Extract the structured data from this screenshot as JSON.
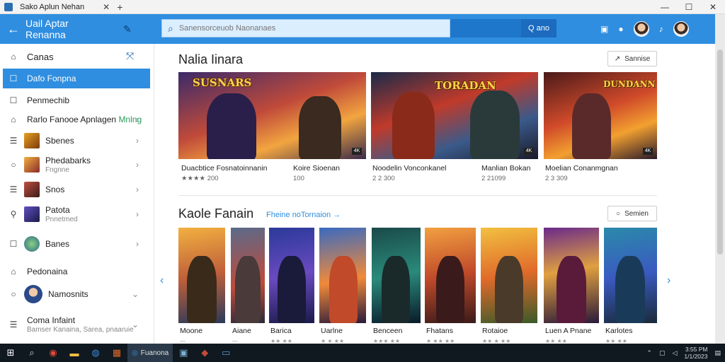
{
  "window": {
    "title": "Sako Aplun Nehan",
    "controls": [
      "—",
      "☐",
      "✕"
    ]
  },
  "header": {
    "app_name": "Uail Aptar Renanna",
    "search_placeholder": "Sanensorceuob Naonanaes",
    "search_button": "Q ano"
  },
  "sidebar": {
    "items": [
      {
        "label": "Canas",
        "icon": "home-icon"
      },
      {
        "label": "Dafo Fonpna",
        "icon": "square-icon",
        "active": true
      },
      {
        "label": "Penmechib",
        "icon": "checkbox-icon"
      },
      {
        "label": "Rarlo Fanooe Apnlagen",
        "label_accent": "Mnlng",
        "icon": "home-icon"
      },
      {
        "label": "Sbenes",
        "icon": "list-icon"
      },
      {
        "label": "Phedabarks",
        "sub": "Fngnne",
        "icon": "chat-icon"
      },
      {
        "label": "Snos",
        "icon": "list-icon"
      },
      {
        "label": "Patota",
        "sub": "Pnnetmed",
        "icon": "pin-icon"
      },
      {
        "label": "Banes",
        "icon": "checkbox-icon"
      },
      {
        "label": "Pedonaina",
        "icon": "home-icon"
      },
      {
        "label": "Namosnits",
        "icon": "chat-icon"
      },
      {
        "label": "Coma Infaint",
        "sub": "Bamser Kanaina, Sarea, pnaaruie",
        "icon": "list-icon"
      }
    ]
  },
  "featured": {
    "title": "Nalia Iinara",
    "button": "Sannise",
    "cards": [
      {
        "name": "Duacbtice Fosnatoinnanin",
        "rating": "★★★★ 200",
        "logo": "SUSNARS",
        "name2": "Koire Sioenan",
        "sub2": "100"
      },
      {
        "name": "Noodelin Vonconkanel",
        "rating": "2 2 300",
        "logo": "TORADAN",
        "name2": "Manlian Bokan",
        "sub2": "2 21099"
      },
      {
        "name": "Moelian Conanmgnan",
        "rating": "2 3 309",
        "logo": "DUNDANN"
      }
    ]
  },
  "recommended": {
    "title": "Kaole Fanain",
    "link": "Fheine noTornaion →",
    "button": "Semien",
    "cards": [
      {
        "name": "Moone",
        "sub": "—"
      },
      {
        "name": "Aiane",
        "sub": "—"
      },
      {
        "name": "Barica",
        "sub": "★★ ★★"
      },
      {
        "name": "Uarlne",
        "sub": "★ ★ ★★"
      },
      {
        "name": "Benceen",
        "sub": "★★★ ★★"
      },
      {
        "name": "Fhatans",
        "sub": "★ ★★ ★★"
      },
      {
        "name": "Rotaioe",
        "sub": "★★ ★ ★★"
      },
      {
        "name": "Luen A Pnane",
        "sub": "★★ ★★"
      },
      {
        "name": "Karlotes",
        "sub": "★★ ★★"
      }
    ]
  },
  "taskbar": {
    "app_label": "Fuanona",
    "clock_time": "3:55 PM",
    "clock_date": "1/1/2023"
  },
  "colors": {
    "accent": "#2f8ee0",
    "header": "#2f8ee0",
    "taskbar": "#101820"
  }
}
